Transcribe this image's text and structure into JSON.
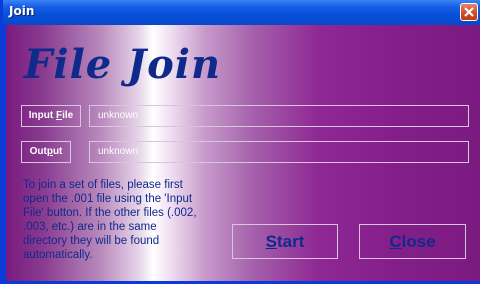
{
  "window": {
    "title": "Join",
    "close_icon": "close-icon"
  },
  "app": {
    "heading": "File Join"
  },
  "input_file": {
    "label_prefix": "Input ",
    "label_mnemonic": "F",
    "label_suffix": "ile",
    "value": "unknown"
  },
  "output": {
    "label_prefix": "Out",
    "label_mnemonic": "p",
    "label_suffix": "ut",
    "value": "unknown"
  },
  "instructions": {
    "lines": [
      "To join a set of files, please first",
      "open the .001 file using the 'Input",
      "File' button. If the other files (.002,",
      ".003, etc.) are in the same",
      "directory they will be found",
      "automatically."
    ]
  },
  "buttons": {
    "start_mnemonic": "S",
    "start_rest": "tart",
    "close_mnemonic": "C",
    "close_rest": "lose"
  },
  "colors": {
    "titlebar": "#0a47c8",
    "heading_text": "#102a8c",
    "purple_edge": "#7a1a80",
    "field_border": "#d8c6dc"
  }
}
